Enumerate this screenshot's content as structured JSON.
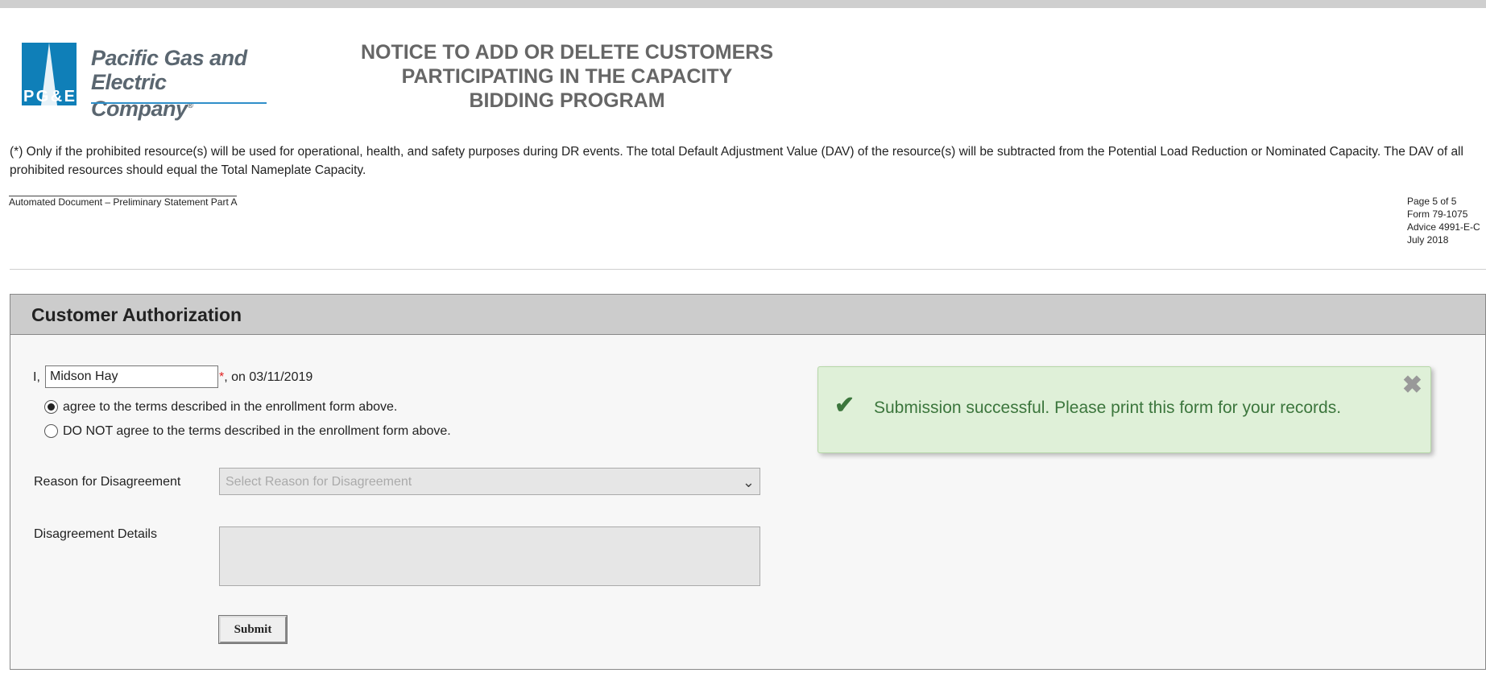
{
  "header": {
    "logo_line1": "Pacific Gas and",
    "logo_line2": "Electric Company",
    "logo_mark": "PG&E",
    "title_line1": "NOTICE TO ADD OR DELETE CUSTOMERS",
    "title_line2": "PARTICIPATING IN THE CAPACITY",
    "title_line3": "BIDDING PROGRAM"
  },
  "footnote": "(*) Only if the prohibited resource(s) will be used for operational, health, and safety purposes during DR events. The total Default Adjustment Value (DAV) of the resource(s) will be subtracted from the Potential Load Reduction or Nominated Capacity. The DAV of all prohibited resources should equal the Total Nameplate Capacity.",
  "auto_doc": "Automated Document – Preliminary Statement Part A",
  "page_meta": {
    "page": "Page 5 of 5",
    "form": "Form 79-1075",
    "advice": "Advice 4991-E-C",
    "date": "July 2018"
  },
  "authorization": {
    "title": "Customer Authorization",
    "prefix": "I,",
    "name_value": "Midson Hay",
    "required_mark": "*",
    "date_text": ", on 03/11/2019",
    "agree_label": "agree to the terms described in the enrollment form above.",
    "disagree_label": "DO NOT agree to the terms described in the enrollment form above.",
    "reason_label": "Reason for Disagreement",
    "reason_placeholder": "Select Reason for Disagreement",
    "details_label": "Disagreement Details",
    "submit_label": "Submit"
  },
  "toast": {
    "message": "Submission successful. Please print this form for your records.",
    "icon": "checkmark-icon",
    "close_icon": "close-icon"
  },
  "colors": {
    "brand_blue": "#0f7fb8",
    "success_bg": "#dff0d8",
    "success_text": "#3c763d",
    "required": "#e02020"
  }
}
